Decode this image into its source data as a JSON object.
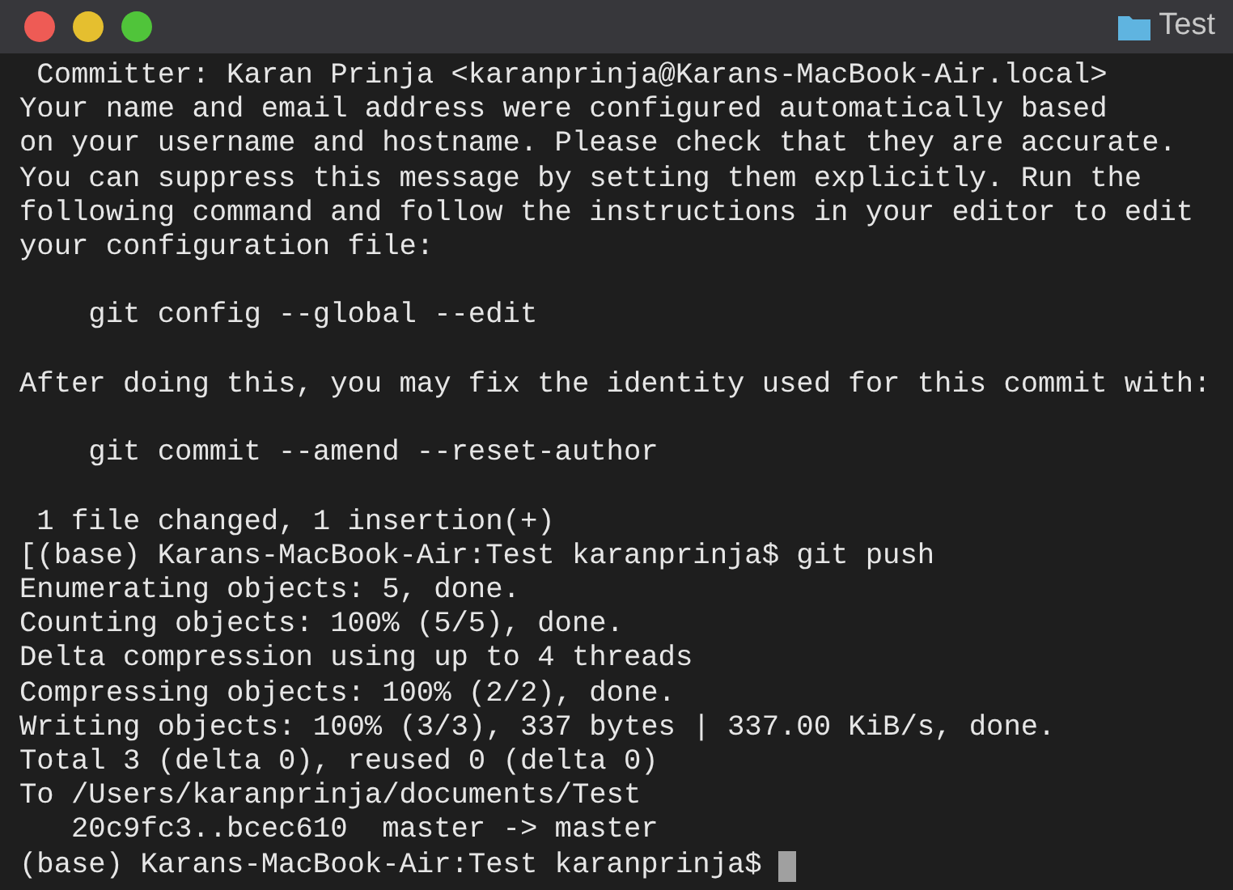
{
  "window": {
    "title": "Test"
  },
  "terminal": {
    "blocks": [
      {
        "lines": [
          " Committer: Karan Prinja <karanprinja@Karans-MacBook-Air.local>",
          "Your name and email address were configured automatically based",
          "on your username and hostname. Please check that they are accurate.",
          "You can suppress this message by setting them explicitly. Run the",
          "following command and follow the instructions in your editor to edit",
          "your configuration file:"
        ]
      },
      {
        "lines": [
          "    git config --global --edit"
        ]
      },
      {
        "lines": [
          "After doing this, you may fix the identity used for this commit with:"
        ]
      },
      {
        "lines": [
          "    git commit --amend --reset-author"
        ]
      },
      {
        "lines": [
          " 1 file changed, 1 insertion(+)",
          "[(base) Karans-MacBook-Air:Test karanprinja$ git push",
          "Enumerating objects: 5, done.",
          "Counting objects: 100% (5/5), done.",
          "Delta compression using up to 4 threads",
          "Compressing objects: 100% (2/2), done.",
          "Writing objects: 100% (3/3), 337 bytes | 337.00 KiB/s, done.",
          "Total 3 (delta 0), reused 0 (delta 0)",
          "To /Users/karanprinja/documents/Test",
          "   20c9fc3..bcec610  master -> master",
          "(base) Karans-MacBook-Air:Test karanprinja$"
        ]
      }
    ]
  }
}
